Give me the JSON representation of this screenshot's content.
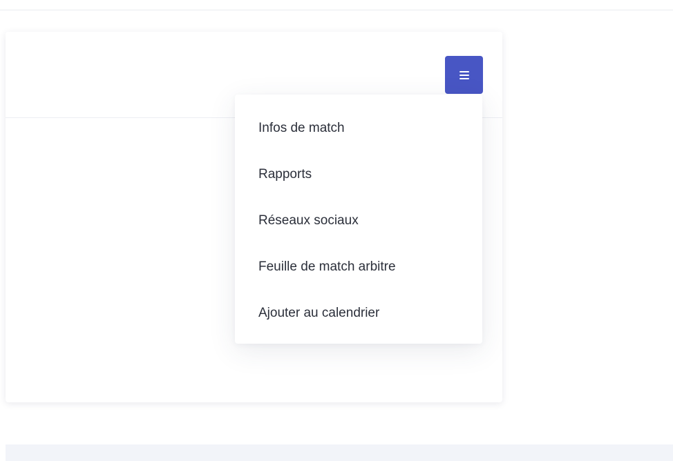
{
  "menu": {
    "icon": "hamburger-icon",
    "button_color": "#4856c4",
    "items": [
      {
        "label": "Infos de match"
      },
      {
        "label": "Rapports"
      },
      {
        "label": "Réseaux sociaux"
      },
      {
        "label": "Feuille de match arbitre"
      },
      {
        "label": "Ajouter au calendrier"
      }
    ]
  }
}
